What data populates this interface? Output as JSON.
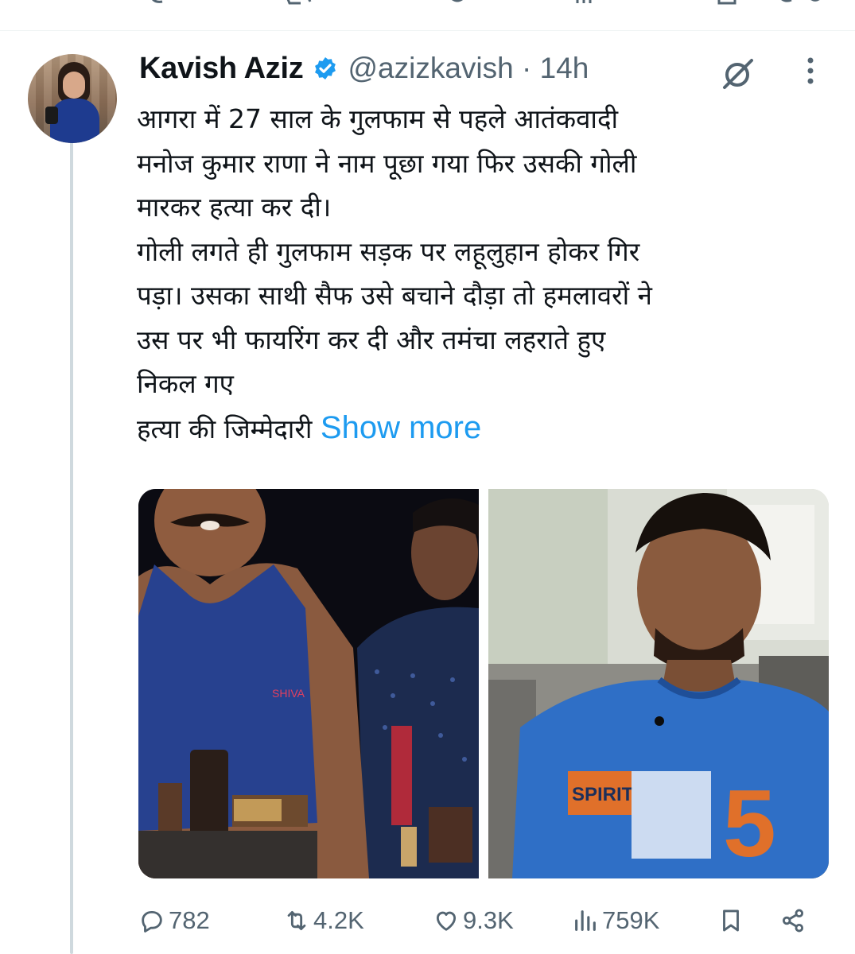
{
  "tweet": {
    "author_name": "Kavish Aziz",
    "handle_time": "@azizkavish · 14h",
    "text_lines": [
      "आगरा में 27 साल के गुलफाम से पहले आतंकवादी",
      "मनोज कुमार राणा ने नाम पूछा गया फिर उसकी गोली",
      "मारकर हत्या कर दी।",
      "गोली लगते ही गुलफाम सड़क पर लहूलुहान होकर गिर",
      "पड़ा। उसका साथी सैफ उसे बचाने दौड़ा तो हमलावरों ने",
      "उस पर भी फायरिंग कर दी और तमंचा लहराते हुए",
      "निकल गए"
    ],
    "truncated_line": "हत्या की जिम्मेदारी",
    "show_more_label": "Show more",
    "shirt_logo_text": "SHIVA",
    "tshirt_print_text": "SPIRIT",
    "tshirt_number": "5"
  },
  "stats": {
    "replies": "782",
    "reposts": "4.2K",
    "likes": "9.3K",
    "views": "759K"
  },
  "colors": {
    "link": "#1d9bf0",
    "secondary_text": "#536471",
    "verified_badge": "#1d9bf0",
    "thread_line": "#cfd9de"
  },
  "icons": [
    "verified-badge-icon",
    "grok-icon",
    "more-icon",
    "reply-icon",
    "repost-icon",
    "like-icon",
    "views-icon",
    "bookmark-icon",
    "share-icon"
  ]
}
